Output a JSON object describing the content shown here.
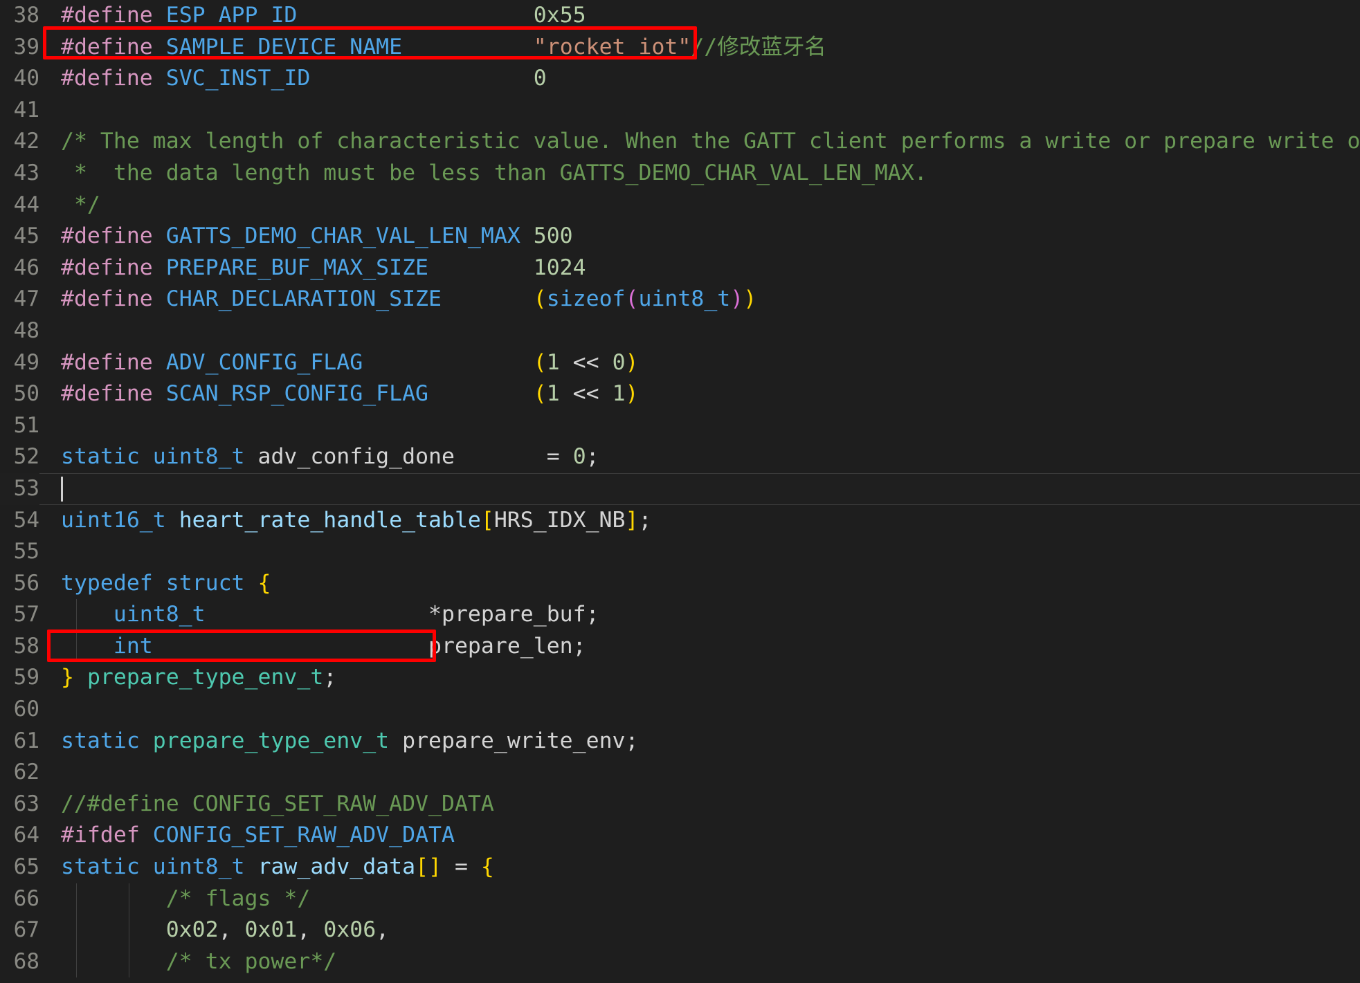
{
  "editor": {
    "background": "#1e1e1e",
    "gutter_color": "#8a8a84",
    "first_visible_line": 38,
    "last_visible_line": 68,
    "cursor_line": 53,
    "annotation_color": "#fe0000"
  },
  "line_numbers": [
    "38",
    "39",
    "40",
    "41",
    "42",
    "43",
    "44",
    "45",
    "46",
    "47",
    "48",
    "49",
    "50",
    "51",
    "52",
    "53",
    "54",
    "55",
    "56",
    "57",
    "58",
    "59",
    "60",
    "61",
    "62",
    "63",
    "64",
    "65",
    "66",
    "67",
    "68"
  ],
  "lines": [
    {
      "n": "38",
      "text": "#define ESP_APP_ID                  0x55"
    },
    {
      "n": "39",
      "text": "#define SAMPLE_DEVICE_NAME          \"rocket_iot\"//修改蓝牙名"
    },
    {
      "n": "40",
      "text": "#define SVC_INST_ID                 0"
    },
    {
      "n": "41",
      "text": ""
    },
    {
      "n": "42",
      "text": "/* The max length of characteristic value. When the GATT client performs a write or prepare write op"
    },
    {
      "n": "43",
      "text": " *  the data length must be less than GATTS_DEMO_CHAR_VAL_LEN_MAX."
    },
    {
      "n": "44",
      "text": " */"
    },
    {
      "n": "45",
      "text": "#define GATTS_DEMO_CHAR_VAL_LEN_MAX 500"
    },
    {
      "n": "46",
      "text": "#define PREPARE_BUF_MAX_SIZE        1024"
    },
    {
      "n": "47",
      "text": "#define CHAR_DECLARATION_SIZE       (sizeof(uint8_t))"
    },
    {
      "n": "48",
      "text": ""
    },
    {
      "n": "49",
      "text": "#define ADV_CONFIG_FLAG             (1 << 0)"
    },
    {
      "n": "50",
      "text": "#define SCAN_RSP_CONFIG_FLAG        (1 << 1)"
    },
    {
      "n": "51",
      "text": ""
    },
    {
      "n": "52",
      "text": "static uint8_t adv_config_done       = 0;"
    },
    {
      "n": "53",
      "text": ""
    },
    {
      "n": "54",
      "text": "uint16_t heart_rate_handle_table[HRS_IDX_NB];"
    },
    {
      "n": "55",
      "text": ""
    },
    {
      "n": "56",
      "text": "typedef struct {"
    },
    {
      "n": "57",
      "text": "    uint8_t                 *prepare_buf;"
    },
    {
      "n": "58",
      "text": "    int                     prepare_len;"
    },
    {
      "n": "59",
      "text": "} prepare_type_env_t;"
    },
    {
      "n": "60",
      "text": ""
    },
    {
      "n": "61",
      "text": "static prepare_type_env_t prepare_write_env;"
    },
    {
      "n": "62",
      "text": ""
    },
    {
      "n": "63",
      "text": "//#define CONFIG_SET_RAW_ADV_DATA"
    },
    {
      "n": "64",
      "text": "#ifdef CONFIG_SET_RAW_ADV_DATA"
    },
    {
      "n": "65",
      "text": "static uint8_t raw_adv_data[] = {"
    },
    {
      "n": "66",
      "text": "        /* flags */"
    },
    {
      "n": "67",
      "text": "        0x02, 0x01, 0x06,"
    },
    {
      "n": "68",
      "text": "        /* tx power*/"
    }
  ],
  "annotations": [
    {
      "label": "sample-device-name-highlight",
      "target_line": "39"
    },
    {
      "label": "config-set-raw-adv-data-highlight",
      "target_line": "63"
    }
  ]
}
